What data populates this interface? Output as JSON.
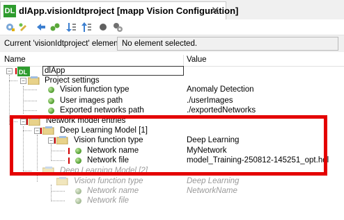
{
  "tab": {
    "icon_text": "DL",
    "title": "dlApp.visionIdtproject [mapp Vision Configuration]",
    "close": "✕"
  },
  "toolbar": {
    "icons": [
      "add-vision-application-icon",
      "edit-icon",
      "navigate-icon",
      "expand-icon",
      "sort-down-icon",
      "sort-up-icon",
      "record-icon",
      "settings-icon"
    ]
  },
  "element_bar": {
    "label": "Current 'visionIdtproject' element:",
    "value": "No element selected."
  },
  "columns": {
    "name": "Name",
    "value": "Value"
  },
  "tree": {
    "root": {
      "label": "dlApp"
    },
    "project_settings": {
      "label": "Project settings",
      "items": [
        {
          "name": "Vision function type",
          "value": "Anomaly Detection"
        },
        {
          "name": "User images path",
          "value": "./userImages"
        },
        {
          "name": "Exported networks path",
          "value": "./exportedNetworks"
        }
      ]
    },
    "network_model_entries": {
      "label": "Network model entries",
      "models": [
        {
          "label": "Deep Learning Model [1]",
          "function": {
            "name": "Vision function type",
            "value": "Deep Learning"
          },
          "items": [
            {
              "name": "Network name",
              "value": "MyNetwork"
            },
            {
              "name": "Network file",
              "value": "model_Training-250812-145251_opt.hdl"
            }
          ]
        },
        {
          "label": "Deep Learning Model [2]",
          "function": {
            "name": "Vision function type",
            "value": "Deep Learning"
          },
          "items": [
            {
              "name": "Network name",
              "value": "NetworkName"
            },
            {
              "name": "Network file",
              "value": ""
            }
          ]
        }
      ]
    }
  },
  "colors": {
    "highlight": "#e40000",
    "leaf_green": "#4c9a2a",
    "disabled_text": "#9a9a9a"
  }
}
